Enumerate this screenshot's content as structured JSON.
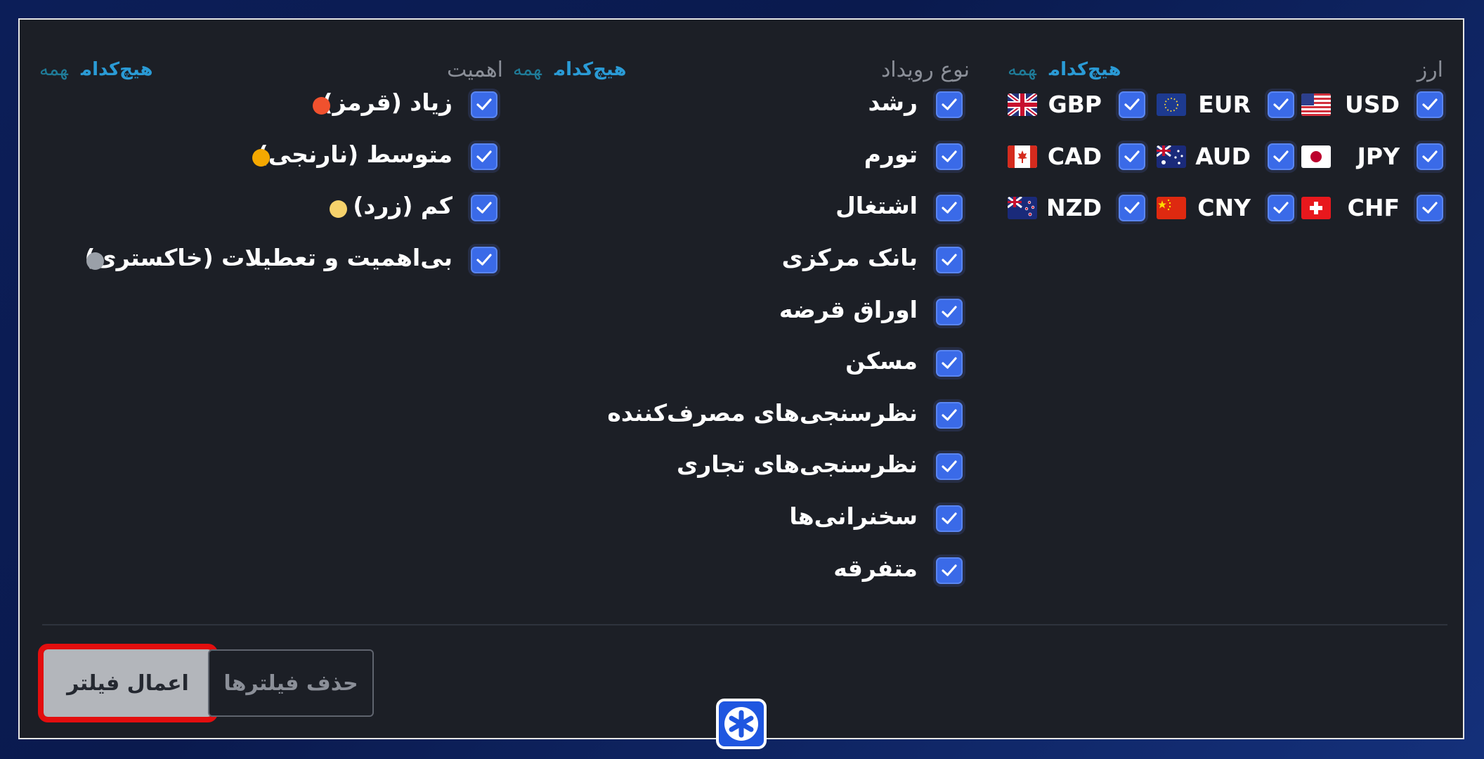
{
  "filters": {
    "currency": {
      "title": "ارز",
      "select_all": "همه",
      "select_none": "هیچ‌کدام",
      "items": [
        {
          "code": "USD",
          "checked": true,
          "flag": "us-flag-icon"
        },
        {
          "code": "EUR",
          "checked": true,
          "flag": "eu-flag-icon"
        },
        {
          "code": "GBP",
          "checked": true,
          "flag": "gb-flag-icon"
        },
        {
          "code": "JPY",
          "checked": true,
          "flag": "jp-flag-icon"
        },
        {
          "code": "AUD",
          "checked": true,
          "flag": "au-flag-icon"
        },
        {
          "code": "CAD",
          "checked": true,
          "flag": "ca-flag-icon"
        },
        {
          "code": "CHF",
          "checked": true,
          "flag": "ch-flag-icon"
        },
        {
          "code": "CNY",
          "checked": true,
          "flag": "cn-flag-icon"
        },
        {
          "code": "NZD",
          "checked": true,
          "flag": "nz-flag-icon"
        }
      ]
    },
    "event_type": {
      "title": "نوع رویداد",
      "select_all": "همه",
      "select_none": "هیچ‌کدام",
      "items": [
        {
          "label": "رشد",
          "checked": true
        },
        {
          "label": "تورم",
          "checked": true
        },
        {
          "label": "اشتغال",
          "checked": true
        },
        {
          "label": "بانک مرکزی",
          "checked": true
        },
        {
          "label": "اوراق قرضه",
          "checked": true
        },
        {
          "label": "مسکن",
          "checked": true
        },
        {
          "label": "نظرسنجی‌های مصرف‌کننده",
          "checked": true
        },
        {
          "label": "نظرسنجی‌های تجاری",
          "checked": true
        },
        {
          "label": "سخنرانی‌ها",
          "checked": true
        },
        {
          "label": "متفرقه",
          "checked": true
        }
      ]
    },
    "importance": {
      "title": "اهمیت",
      "select_all": "همه",
      "select_none": "هیچ‌کدام",
      "items": [
        {
          "label": "زیاد (قرمز)",
          "checked": true,
          "color": "#f0512e"
        },
        {
          "label": "متوسط (نارنجی)",
          "checked": true,
          "color": "#f5a800"
        },
        {
          "label": "کم (زرد)",
          "checked": true,
          "color": "#f6d26b"
        },
        {
          "label": "بی‌اهمیت و تعطیلات (خاکستری)",
          "checked": true,
          "color": "#9aa0a8"
        }
      ]
    }
  },
  "actions": {
    "apply": "اعمال فیلتر",
    "clear": "حذف فیلترها"
  },
  "fab_icon": "asterisk-icon",
  "colors": {
    "panel_bg": "#1c1f26",
    "checkbox": "#3a6ae8",
    "link": "#2a9bd6",
    "highlight": "#e30e0e"
  }
}
